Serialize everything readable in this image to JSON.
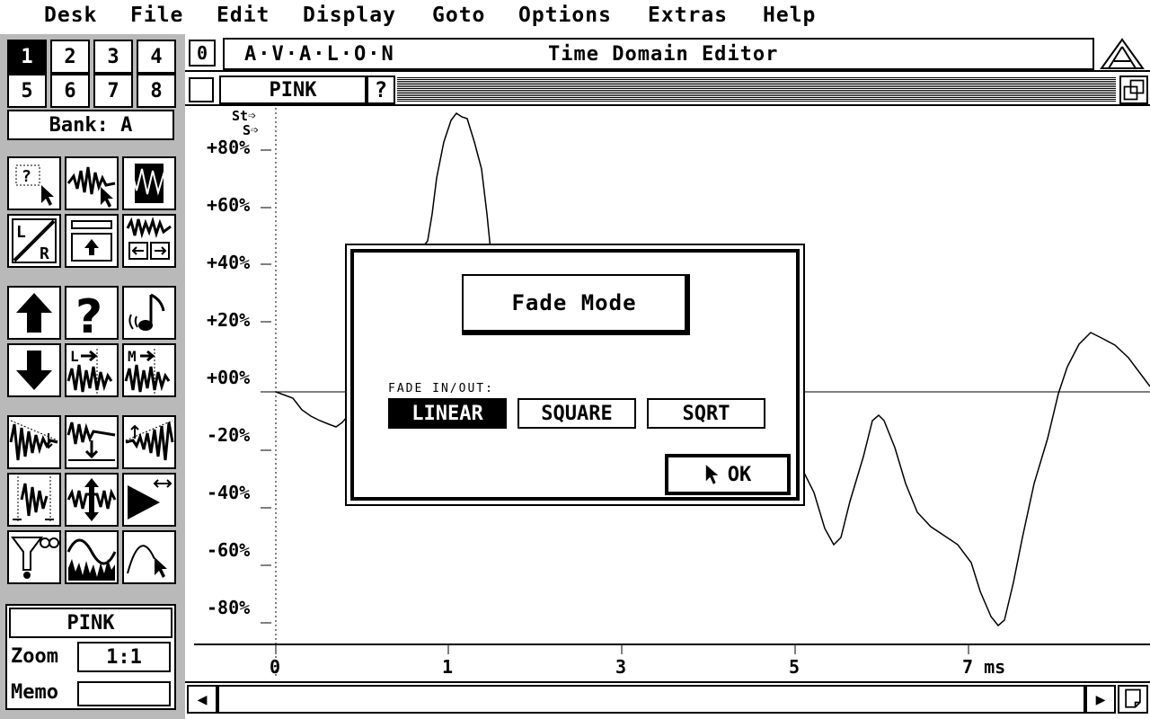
{
  "menu": {
    "items": [
      "Desk",
      "File",
      "Edit",
      "Display",
      "Goto",
      "Options",
      "Extras",
      "Help"
    ]
  },
  "banks": {
    "numbers": [
      "1",
      "2",
      "3",
      "4",
      "5",
      "6",
      "7",
      "8"
    ],
    "selected": "1",
    "label": "Bank: A"
  },
  "window": {
    "close_glyph": "0",
    "app_name": "A·V·A·L·O·N",
    "title": "Time Domain Editor"
  },
  "sample": {
    "name": "PINK",
    "help_glyph": "?"
  },
  "markers": {
    "start": "St",
    "s": "S"
  },
  "yaxis": {
    "labels": [
      "+80%",
      "+60%",
      "+40%",
      "+20%",
      "+00%",
      "-20%",
      "-40%",
      "-60%",
      "-80%"
    ]
  },
  "xaxis": {
    "labels": [
      "0",
      "1",
      "3",
      "5",
      "7 ms"
    ]
  },
  "info": {
    "name": "PINK",
    "zoom_label": "Zoom",
    "zoom_value": "1:1",
    "memo_label": "Memo",
    "memo_value": ""
  },
  "tools": [
    "select-region-icon",
    "select-wave-icon",
    "wave-view-icon",
    "left-right-icon",
    "upload-icon",
    "stretch-icon",
    "arrow-up-icon",
    "help-icon",
    "sound-icon",
    "arrow-down-icon",
    "loop-left-icon",
    "loop-mix-icon",
    "fade-out-icon",
    "fade-down-icon",
    "fade-in-icon",
    "marker-cut-icon",
    "amplify-icon",
    "play-shift-icon",
    "filter-icon",
    "sine-wave-icon",
    "draw-wave-icon"
  ],
  "dialog": {
    "title": "Fade Mode",
    "section_label": "FADE IN/OUT:",
    "options": [
      "LINEAR",
      "SQUARE",
      "SQRT"
    ],
    "selected": "LINEAR",
    "ok_label": "OK"
  },
  "colors": {
    "foreground": "#000000",
    "background": "#ffffff"
  }
}
